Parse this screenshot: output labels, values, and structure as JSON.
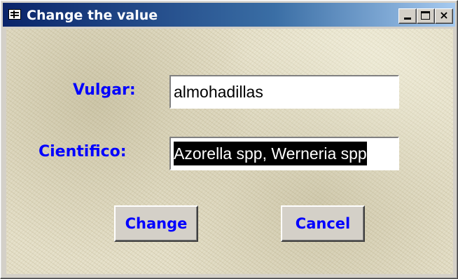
{
  "window": {
    "title": "Change the value",
    "controls": {
      "minimize": "_",
      "maximize": "□",
      "close": "×"
    }
  },
  "form": {
    "vulgar_label": "Vulgar:",
    "vulgar_value": "almohadillas",
    "cientifico_label": "Cientifico:",
    "cientifico_value": "Azorella spp, Werneria spp"
  },
  "buttons": {
    "change": "Change",
    "cancel": "Cancel"
  },
  "colors": {
    "titlebar_start": "#0a246a",
    "label_text": "#0000ff",
    "background": "#e2dcc4"
  }
}
